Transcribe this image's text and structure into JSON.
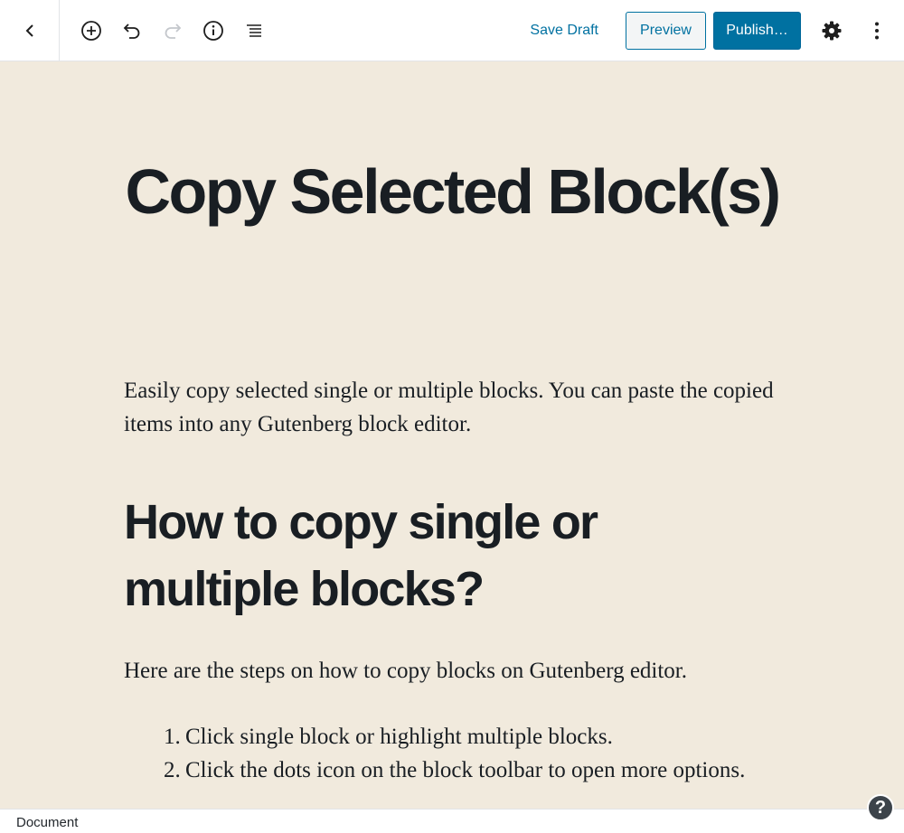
{
  "toolbar": {
    "icons": {
      "back": "chevron-left-icon",
      "add": "plus-circle-icon",
      "undo": "undo-icon",
      "redo": "redo-icon",
      "info": "info-icon",
      "outline": "list-icon",
      "settings": "gear-icon",
      "more": "more-vertical-icon"
    },
    "save_draft_label": "Save Draft",
    "preview_label": "Preview",
    "publish_label": "Publish…"
  },
  "post": {
    "title": "Copy Selected Block(s)",
    "intro": "Easily copy selected single or multiple blocks. You can paste the copied items into any Gutenberg block editor.",
    "heading": "How to copy single or multiple blocks?",
    "steps_intro": "Here are the steps on how to copy blocks on Gutenberg editor.",
    "steps": [
      {
        "num": "1.",
        "text": "Click single block or highlight multiple blocks."
      },
      {
        "num": "2.",
        "text": "Click the dots icon on the block toolbar to open more options."
      }
    ]
  },
  "footer": {
    "label": "Document",
    "help": "?"
  },
  "colors": {
    "accent": "#0071a1",
    "canvas": "#f1eadd",
    "text": "#191e23"
  }
}
